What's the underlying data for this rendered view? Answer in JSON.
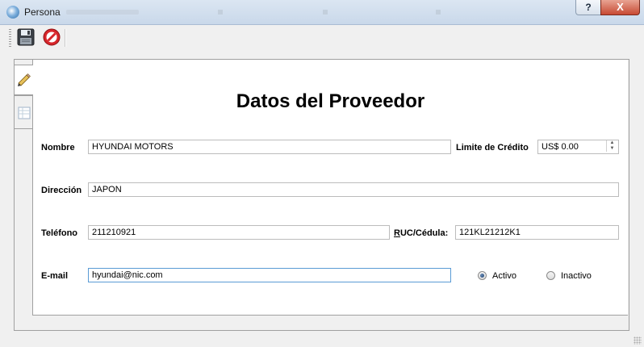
{
  "window": {
    "title": "Persona",
    "help_label": "?",
    "close_label": "X"
  },
  "toolbar": {
    "save_icon": "floppy-disk-icon",
    "cancel_icon": "no-entry-icon"
  },
  "tabs": [
    {
      "icon": "pencil-icon",
      "selected": true
    },
    {
      "icon": "table-icon",
      "selected": false
    }
  ],
  "form": {
    "heading": "Datos del Proveedor",
    "nombre": {
      "label": "Nombre",
      "value": "HYUNDAI MOTORS"
    },
    "limite": {
      "label": "Limite de Crédito",
      "value": "US$ 0.00"
    },
    "direccion": {
      "label": "Dirección",
      "value": "JAPON"
    },
    "telefono": {
      "label": "Teléfono",
      "value": "211210921"
    },
    "ruc": {
      "label_prefix": "R",
      "label_rest": "UC/Cédula:",
      "value": "121KL21212K1"
    },
    "email": {
      "label": "E-mail",
      "value": "hyundai@nic.com"
    },
    "status": {
      "activo_label": "Activo",
      "inactivo_label": "Inactivo",
      "selected": "Activo"
    }
  },
  "colors": {
    "focus_border": "#5a9bd5",
    "close_button": "#c74a33"
  }
}
